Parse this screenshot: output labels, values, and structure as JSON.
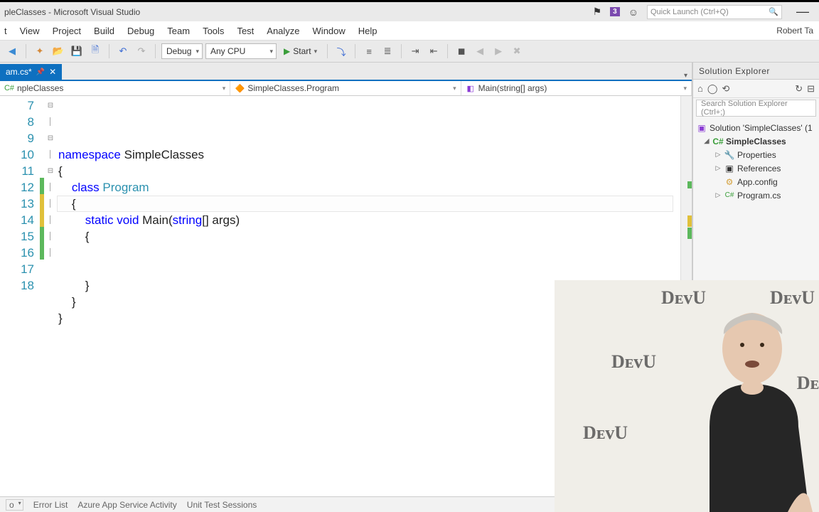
{
  "titlebar": {
    "title": "pleClasses - Microsoft Visual Studio",
    "notif_count": "3",
    "quick_launch_placeholder": "Quick Launch (Ctrl+Q)"
  },
  "menubar": {
    "items": [
      "t",
      "View",
      "Project",
      "Build",
      "Debug",
      "Team",
      "Tools",
      "Test",
      "Analyze",
      "Window",
      "Help"
    ],
    "user": "Robert Ta"
  },
  "toolbar": {
    "config": "Debug",
    "platform": "Any CPU",
    "start_label": "Start"
  },
  "tabs": {
    "file": "am.cs*"
  },
  "context": {
    "namespace": "npleClasses",
    "class": "SimpleClasses.Program",
    "method": "Main(string[] args)"
  },
  "code": {
    "line_numbers": [
      "7",
      "8",
      "9",
      "10",
      "11",
      "12",
      "13",
      "14",
      "15",
      "16",
      "17",
      "18"
    ],
    "lines": [
      {
        "t": "namespace SimpleClasses",
        "kw": [
          "namespace"
        ],
        "typ": []
      },
      {
        "t": "{"
      },
      {
        "t": "    class Program",
        "kw": [
          "class"
        ],
        "typ": [
          "Program"
        ]
      },
      {
        "t": "    {"
      },
      {
        "t": "        static void Main(string[] args)",
        "kw": [
          "static",
          "void",
          "string"
        ],
        "typ": []
      },
      {
        "t": "        {"
      },
      {
        "t": "            "
      },
      {
        "t": ""
      },
      {
        "t": "        }"
      },
      {
        "t": "    }"
      },
      {
        "t": "}"
      },
      {
        "t": ""
      }
    ],
    "fold_rows": {
      "0": "⊟",
      "2": "⊟",
      "4": "⊟"
    },
    "change_marks": {
      "5": "g",
      "6": "y",
      "7": "y",
      "8": "g",
      "9": "g"
    }
  },
  "solution": {
    "title": "Solution Explorer",
    "search_placeholder": "Search Solution Explorer (Ctrl+;)",
    "root": "Solution 'SimpleClasses' (1",
    "project": "SimpleClasses",
    "items": [
      "Properties",
      "References",
      "App.config",
      "Program.cs"
    ],
    "item_icons": [
      "🔧",
      "▣",
      "⚙",
      "C#"
    ]
  },
  "statusbar": {
    "items": [
      "o",
      "Error List",
      "Azure App Service Activity",
      "Unit Test Sessions"
    ]
  }
}
